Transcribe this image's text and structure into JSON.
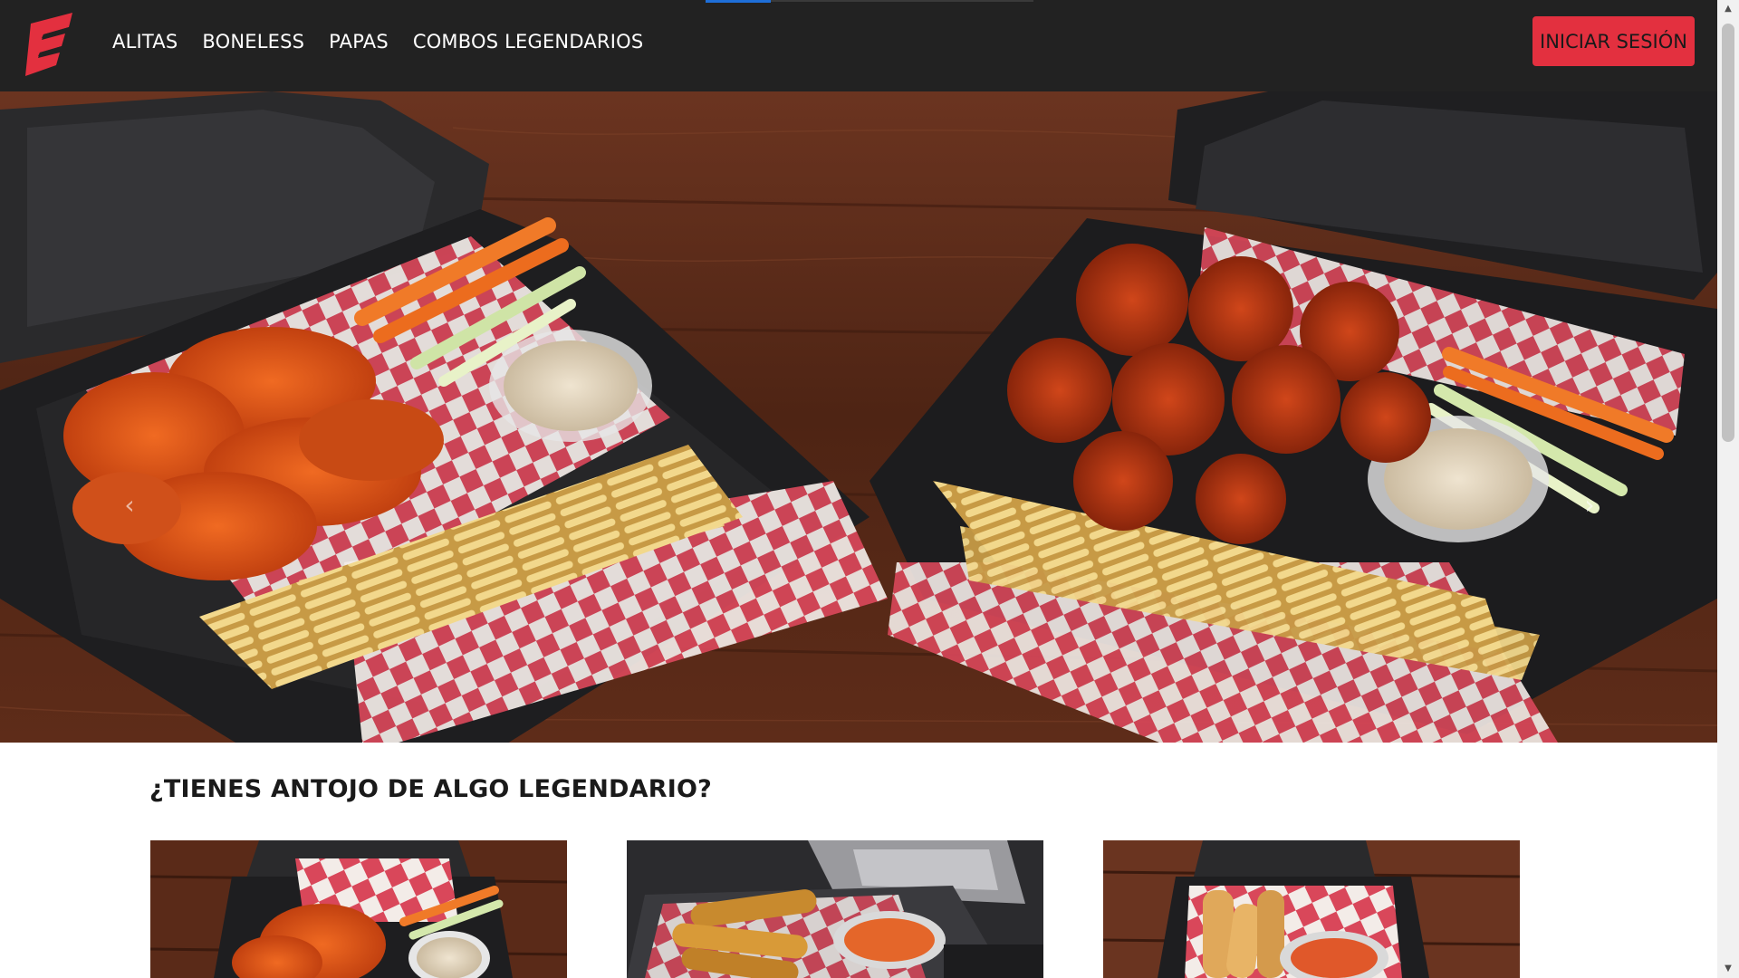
{
  "brand": {
    "logo_icon": "flag-logo-icon",
    "accent": "#e3303f"
  },
  "nav": {
    "links": [
      "ALITAS",
      "BONELESS",
      "PAPAS",
      "COMBOS LEGENDARIOS"
    ],
    "login_label": "INICIAR SESIÓN"
  },
  "hero": {
    "carousel_prev_icon": "chevron-left-icon",
    "carousel_next_icon": "chevron-right-icon",
    "prev_glyph": "‹",
    "next_glyph": "›"
  },
  "section": {
    "title": "¿TIENES ANTOJO DE ALGO LEGENDARIO?"
  },
  "colors": {
    "navbar": "#222222",
    "wood": "#5a2a1a"
  }
}
